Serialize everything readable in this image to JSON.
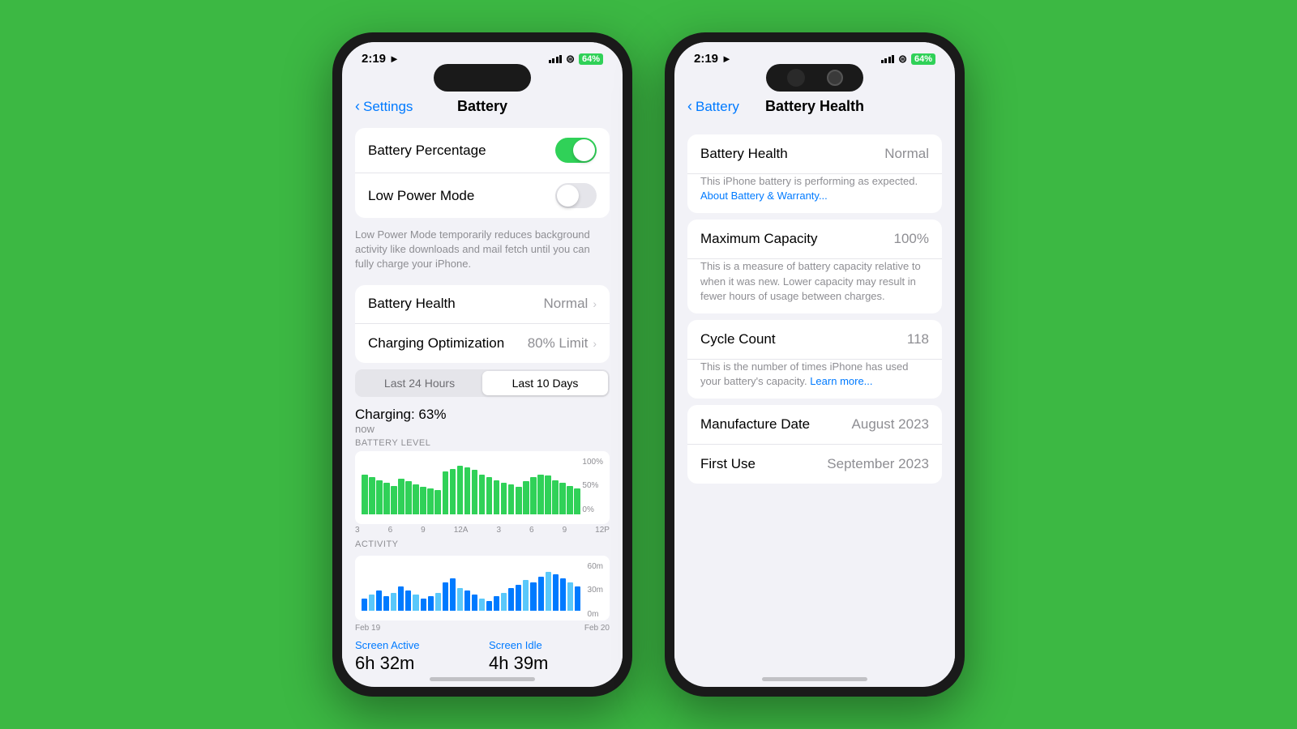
{
  "background": "#3cb843",
  "phone1": {
    "status": {
      "time": "2:19",
      "location": true,
      "signal": "●●●",
      "wifi": "wifi",
      "battery": "64%"
    },
    "nav": {
      "back_label": "Settings",
      "title": "Battery"
    },
    "toggles": {
      "battery_percentage_label": "Battery Percentage",
      "battery_percentage_on": true,
      "low_power_label": "Low Power Mode",
      "low_power_on": false,
      "low_power_description": "Low Power Mode temporarily reduces background activity like downloads and mail fetch until you can fully charge your iPhone."
    },
    "battery_health": {
      "label": "Battery Health",
      "value": "Normal"
    },
    "charging_optimization": {
      "label": "Charging Optimization",
      "value": "80% Limit"
    },
    "tabs": {
      "tab1": "Last 24 Hours",
      "tab2": "Last 10 Days",
      "active": "tab2"
    },
    "charging": {
      "label": "Charging: 63%",
      "time": "now"
    },
    "chart": {
      "y_labels": [
        "100%",
        "50%",
        "0%"
      ],
      "x_labels": [
        "3",
        "6",
        "9",
        "12A",
        "3",
        "6",
        "9",
        "12P"
      ],
      "bars": [
        70,
        65,
        60,
        55,
        50,
        62,
        58,
        52,
        48,
        45,
        42,
        75,
        80,
        85,
        82,
        78,
        70,
        65,
        60,
        55,
        52,
        48,
        58,
        65,
        70,
        68,
        60,
        55,
        50,
        45
      ]
    },
    "activity_chart": {
      "label": "ACTIVITY",
      "y_labels": [
        "60m",
        "30m",
        "0m"
      ],
      "x_labels": [
        "3",
        "6",
        "9",
        "12A",
        "3",
        "6",
        "9",
        "12P"
      ],
      "date_labels": [
        "Feb 19",
        "Feb 20"
      ],
      "bars": [
        15,
        20,
        25,
        18,
        22,
        30,
        25,
        20,
        15,
        18,
        22,
        35,
        40,
        28,
        25,
        20,
        15,
        12,
        18,
        22,
        28,
        32,
        38,
        35,
        42,
        48,
        45,
        40,
        35,
        30
      ]
    },
    "screen_usage": {
      "screen_active_label": "Screen Active",
      "screen_active_value": "6h 32m",
      "screen_idle_label": "Screen Idle",
      "screen_idle_value": "4h 39m"
    }
  },
  "phone2": {
    "status": {
      "time": "2:19",
      "location": true,
      "signal": "●●●",
      "wifi": "wifi",
      "battery": "64%"
    },
    "nav": {
      "back_label": "Battery",
      "title": "Battery Health"
    },
    "battery_health": {
      "label": "Battery Health",
      "value": "Normal",
      "description": "This iPhone battery is performing as expected.",
      "link": "About Battery & Warranty..."
    },
    "maximum_capacity": {
      "label": "Maximum Capacity",
      "value": "100%",
      "description": "This is a measure of battery capacity relative to when it was new. Lower capacity may result in fewer hours of usage between charges."
    },
    "cycle_count": {
      "label": "Cycle Count",
      "value": "118",
      "description": "This is the number of times iPhone has used your battery's capacity.",
      "link": "Learn more..."
    },
    "manufacture_date": {
      "label": "Manufacture Date",
      "value": "August 2023"
    },
    "first_use": {
      "label": "First Use",
      "value": "September 2023"
    }
  }
}
